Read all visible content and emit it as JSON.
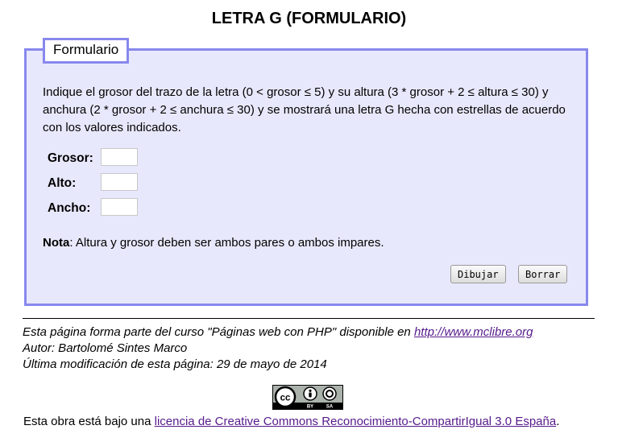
{
  "page": {
    "title": "LETRA G (FORMULARIO)"
  },
  "form": {
    "legend": "Formulario",
    "description": "Indique el grosor del trazo de la letra (0 < grosor ≤ 5) y su altura (3 * grosor + 2 ≤ altura ≤ 30) y anchura (2 * grosor + 2 ≤ anchura ≤ 30) y se mostrará una letra G hecha con estrellas de acuerdo con los valores indicados.",
    "fields": [
      {
        "label": "Grosor:",
        "value": ""
      },
      {
        "label": "Alto:",
        "value": ""
      },
      {
        "label": "Ancho:",
        "value": ""
      }
    ],
    "note_label": "Nota",
    "note_text": ": Altura y grosor deben ser ambos pares o ambos impares.",
    "buttons": {
      "submit": "Dibujar",
      "reset": "Borrar"
    }
  },
  "footer": {
    "line1_prefix": "Esta página forma parte del curso \"Páginas web con PHP\" disponible en ",
    "line1_link": "http://www.mclibre.org",
    "line2": "Autor: Bartolomé Sintes Marco",
    "line3": "Última modificación de esta página: 29 de mayo de 2014"
  },
  "license": {
    "badge_icon": "cc-by-sa-icon",
    "badge_text_by": "BY",
    "badge_text_sa": "SA",
    "prefix": "Esta obra está bajo una ",
    "link": "licencia de Creative Commons Reconocimiento-CompartirIgual 3.0 España",
    "suffix": "."
  }
}
